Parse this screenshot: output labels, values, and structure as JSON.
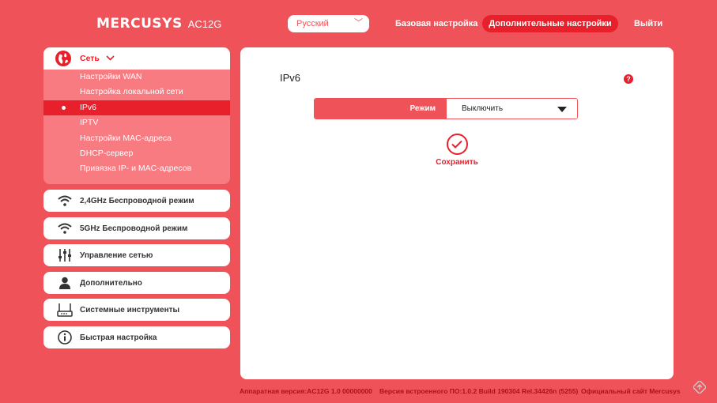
{
  "header": {
    "brand": "MERCUSYS",
    "model": "AC12G",
    "language": "Русский",
    "nav_basic": "Базовая настройка",
    "nav_advanced": "Дополнительные настройки",
    "logout": "Выйти"
  },
  "sidebar": {
    "network": {
      "label": "Сеть",
      "icon": "globe-icon",
      "items": [
        {
          "label": "Настройки WAN"
        },
        {
          "label": "Настройка локальной сети"
        },
        {
          "label": "IPv6",
          "active": true
        },
        {
          "label": "IPTV"
        },
        {
          "label": "Настройки MAC-адреса"
        },
        {
          "label": "DHCP-сервер"
        },
        {
          "label": "Привязка IP- и MAC-адресов"
        }
      ]
    },
    "items": [
      {
        "label": "2,4GHz Беспроводной режим",
        "icon": "wifi-icon"
      },
      {
        "label": "5GHz Беспроводной режим",
        "icon": "wifi-icon"
      },
      {
        "label": "Управление сетью",
        "icon": "sliders-icon"
      },
      {
        "label": "Дополнительно",
        "icon": "user-icon"
      },
      {
        "label": "Системные инструменты",
        "icon": "router-icon"
      },
      {
        "label": "Быстрая настройка",
        "icon": "info-icon"
      }
    ]
  },
  "main": {
    "title": "IPv6",
    "help": "?",
    "mode_label": "Режим",
    "mode_value": "Выключить",
    "save_label": "Сохранить"
  },
  "footer": {
    "hardware": "Аппаратная версия:AC12G 1.0 00000000",
    "firmware": "Версия встроенного ПО:1.0.2 Build 190304 Rel.34426n (5255)",
    "site": "Официальный сайт Mercusys"
  },
  "colors": {
    "background": "#f0525a",
    "accent": "#e8202b",
    "submenu": "#f77b81"
  }
}
